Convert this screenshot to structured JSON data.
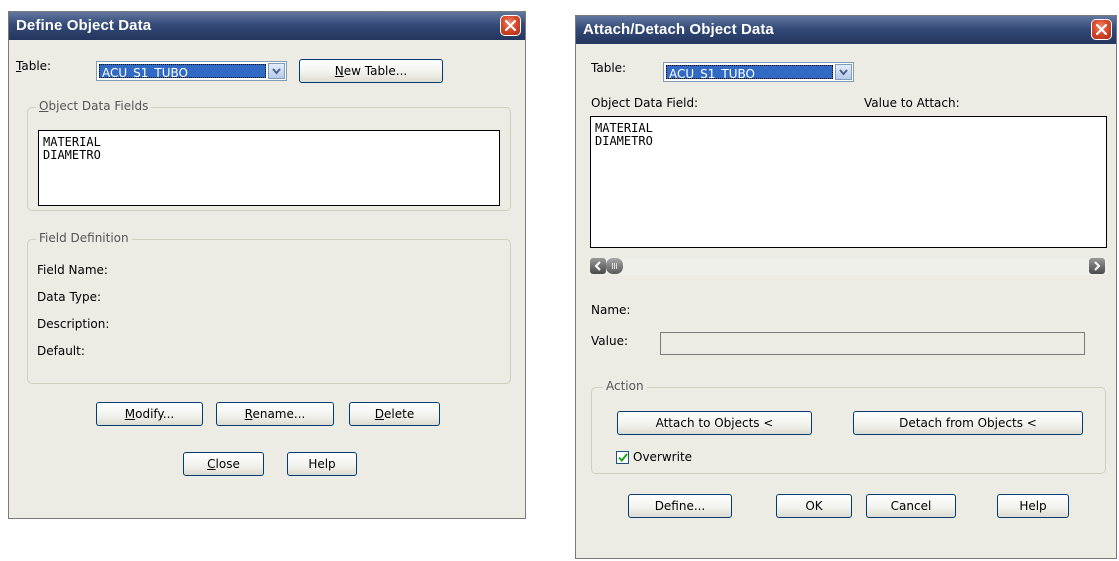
{
  "define_dialog": {
    "title": "Define Object Data",
    "table_label_accel": "T",
    "table_label_rest": "able:",
    "table_value": "ACU_S1_TUBO",
    "new_table_accel": "N",
    "new_table_rest": "ew Table...",
    "fields_group_accel": "O",
    "fields_group_rest": "bject Data Fields",
    "fields": [
      "MATERIAL",
      "DIAMETRO"
    ],
    "field_def_group": "Field Definition",
    "field_name_label": "Field Name:",
    "data_type_label": "Data Type:",
    "description_label": "Description:",
    "default_label": "Default:",
    "modify_accel": "M",
    "modify_rest": "odify...",
    "rename_accel": "R",
    "rename_rest": "ename...",
    "delete_accel": "D",
    "delete_rest": "elete",
    "close_accel": "C",
    "close_rest": "lose",
    "help_label": "Help"
  },
  "attach_dialog": {
    "title": "Attach/Detach Object Data",
    "table_label": "Table:",
    "table_value": "ACU_S1_TUBO",
    "object_data_field_label": "Object Data Field:",
    "value_to_attach_label": "Value to Attach:",
    "fields": [
      "MATERIAL",
      "DIAMETRO"
    ],
    "name_label": "Name:",
    "value_label": "Value:",
    "value_field": "",
    "action_group": "Action",
    "attach_button": "Attach to Objects <",
    "detach_button": "Detach from Objects <",
    "overwrite_label": "Overwrite",
    "overwrite_checked": true,
    "define_button": "Define...",
    "ok_button": "OK",
    "cancel_button": "Cancel",
    "help_button": "Help"
  },
  "colors": {
    "titlebar": "#22355e",
    "dialog_bg": "#ecebe4",
    "selection": "#316ac5",
    "close_button": "#d84a2a"
  },
  "icons": {
    "close": "close-x-icon",
    "dropdown": "chevron-down-icon",
    "scroll_left": "scroll-left-icon",
    "scroll_right": "scroll-right-icon",
    "checkbox": "checkmark-icon"
  }
}
